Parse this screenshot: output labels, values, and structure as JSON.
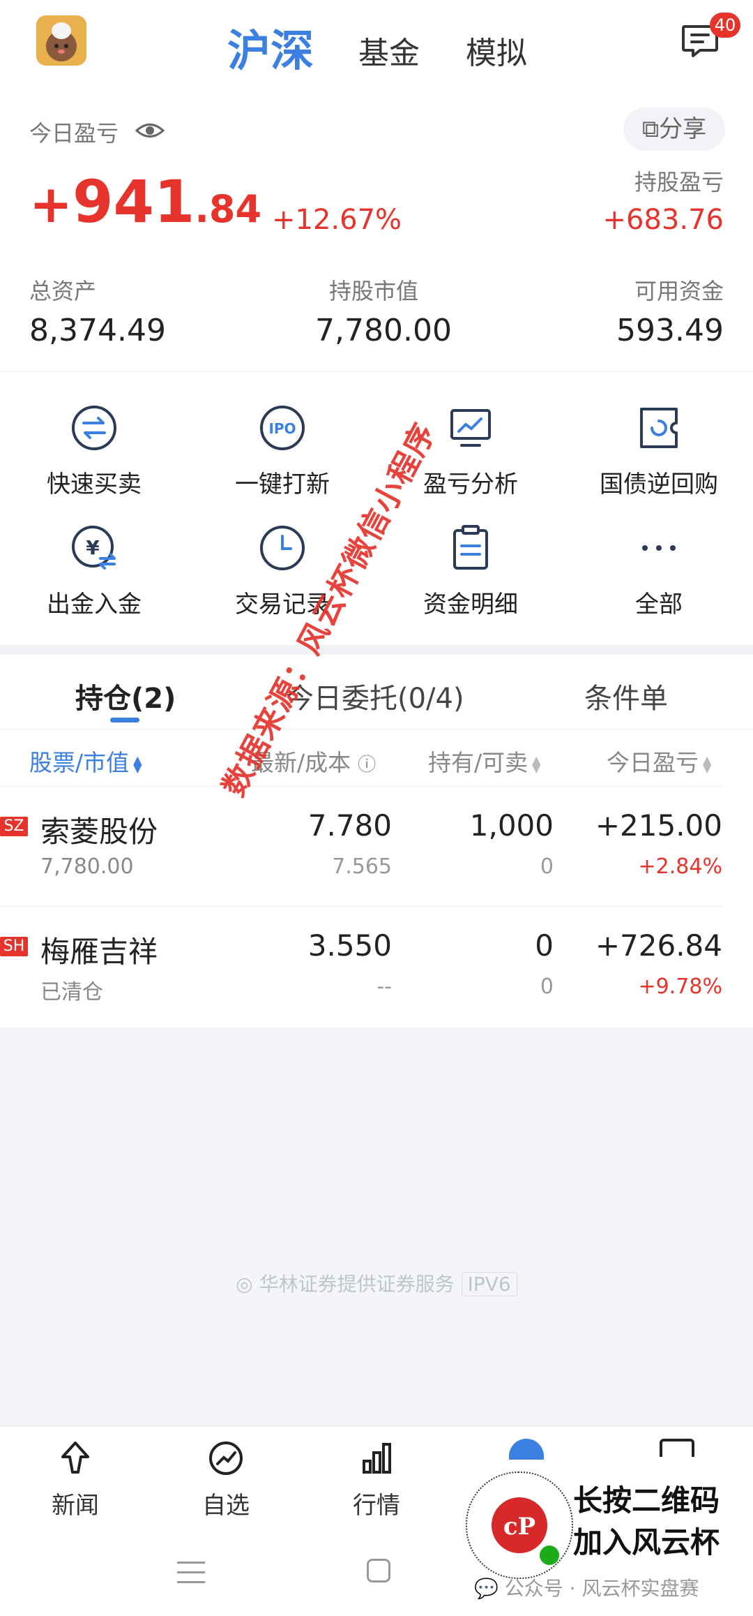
{
  "header": {
    "tabs": [
      "沪深",
      "基金",
      "模拟"
    ],
    "active_tab": "沪深",
    "message_badge": "40"
  },
  "summary": {
    "today_pl_label": "今日盈亏",
    "today_pl_sign": "+",
    "today_pl_int": "941",
    "today_pl_dec": ".84",
    "today_pl_pct": "+12.67%",
    "share_label": "分享",
    "holding_pl_label": "持股盈亏",
    "holding_pl_value": "+683.76",
    "total_assets_label": "总资产",
    "total_assets_value": "8,374.49",
    "market_value_label": "持股市值",
    "market_value_value": "7,780.00",
    "available_label": "可用资金",
    "available_value": "593.49"
  },
  "grid": [
    {
      "label": "快速买卖",
      "icon": "swap-arrows-icon"
    },
    {
      "label": "一键打新",
      "icon": "ipo-icon"
    },
    {
      "label": "盈亏分析",
      "icon": "chart-monitor-icon"
    },
    {
      "label": "国债逆回购",
      "icon": "bond-repo-icon"
    },
    {
      "label": "出金入金",
      "icon": "yuan-transfer-icon"
    },
    {
      "label": "交易记录",
      "icon": "clock-icon"
    },
    {
      "label": "资金明细",
      "icon": "clipboard-icon"
    },
    {
      "label": "全部",
      "icon": "more-dots-icon"
    }
  ],
  "positions": {
    "tabs": [
      "持仓(2)",
      "今日委托(0/4)",
      "条件单"
    ],
    "columns": [
      "股票/市值",
      "最新/成本",
      "持有/可卖",
      "今日盈亏"
    ],
    "rows": [
      {
        "market": "SZ",
        "name": "索菱股份",
        "sub": "7,780.00",
        "latest": "7.780",
        "cost": "7.565",
        "hold": "1,000",
        "sellable": "0",
        "pl": "+215.00",
        "pl_pct": "+2.84%"
      },
      {
        "market": "SH",
        "name": "梅雁吉祥",
        "sub": "已清仓",
        "latest": "3.550",
        "cost": "--",
        "hold": "0",
        "sellable": "0",
        "pl": "+726.84",
        "pl_pct": "+9.78%"
      }
    ]
  },
  "footer_note": "华林证券提供证券服务",
  "footer_tag": "IPV6",
  "bottom_nav": [
    {
      "label": "新闻",
      "icon": "news-icon"
    },
    {
      "label": "自选",
      "icon": "watchlist-icon"
    },
    {
      "label": "行情",
      "icon": "market-bars-icon"
    }
  ],
  "watermark": "数据来源：风云杯微信小程序",
  "overlay": {
    "line1": "长按二维码",
    "line2": "加入风云杯",
    "wechat": "公众号 · 风云杯实盘赛"
  },
  "colors": {
    "accent": "#3b7fe0",
    "up": "#e6332b"
  }
}
